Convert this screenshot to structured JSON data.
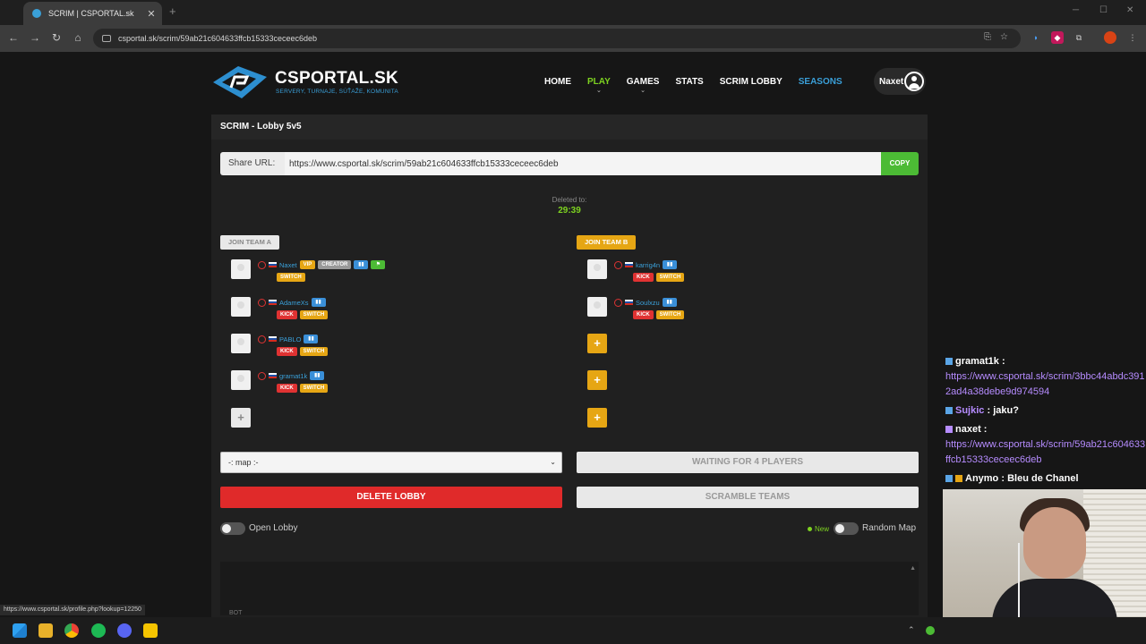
{
  "browser": {
    "tab_title": "SCRIM | CSPORTAL.sk",
    "url": "csportal.sk/scrim/59ab21c604633ffcb15333ceceec6deb",
    "status_url": "https://www.csportal.sk/profile.php?lookup=12250"
  },
  "site": {
    "logo_text": "CSPORTAL.SK",
    "logo_sub": "SERVERY, TURNAJE, SÚŤAŽE, KOMUNITA",
    "menu": [
      "HOME",
      "PLAY",
      "GAMES",
      "STATS",
      "SCRIM LOBBY",
      "SEASONS"
    ],
    "user": "Naxet"
  },
  "lobby": {
    "title": "SCRIM - Lobby 5v5",
    "share_label": "Share URL:",
    "share_url": "https://www.csportal.sk/scrim/59ab21c604633ffcb15333ceceec6deb",
    "copy_label": "COPY",
    "deleted_label": "Deleted to:",
    "timer": "29:39",
    "join_a": "JOIN TEAM A",
    "join_b": "JOIN TEAM B",
    "badges": {
      "vip": "VIP",
      "creator": "CREATOR",
      "kick": "KICK",
      "switch": "SWITCH"
    },
    "team_a": [
      {
        "name": "Naxet"
      },
      {
        "name": "AdameXs"
      },
      {
        "name": "PABLO"
      },
      {
        "name": "gramat1k"
      }
    ],
    "team_b": [
      {
        "name": "karrig4n"
      },
      {
        "name": "Soulxzu"
      }
    ],
    "map_placeholder": "-: map :-",
    "waiting_label": "WAITING FOR 4 PLAYERS",
    "delete_label": "DELETE LOBBY",
    "scramble_label": "SCRAMBLE TEAMS",
    "open_lobby_label": "Open Lobby",
    "new_label": "New",
    "random_map_label": "Random Map",
    "chat_cutoff": "BOT"
  },
  "stream_chat": [
    {
      "user": "gramat1k",
      "sep": " :",
      "text": "https://www.csportal.sk/scrim/3bbc44abdc3912ad4a38debe9d974594",
      "is_link": true
    },
    {
      "user": "Sujkic",
      "sep": " :",
      "text": "jaku?",
      "is_link": false
    },
    {
      "user": "naxet",
      "sep": " :",
      "text": "https://www.csportal.sk/scrim/59ab21c604633ffcb15333ceceec6deb",
      "is_link": true
    },
    {
      "user": "Anymo",
      "sep": " :",
      "text": "Bleu de Chanel",
      "is_link": false
    }
  ],
  "colors": {
    "accent_green": "#7ed320",
    "accent_blue": "#3a9fd8",
    "accent_orange": "#e6a614",
    "danger_red": "#e02a2a"
  }
}
